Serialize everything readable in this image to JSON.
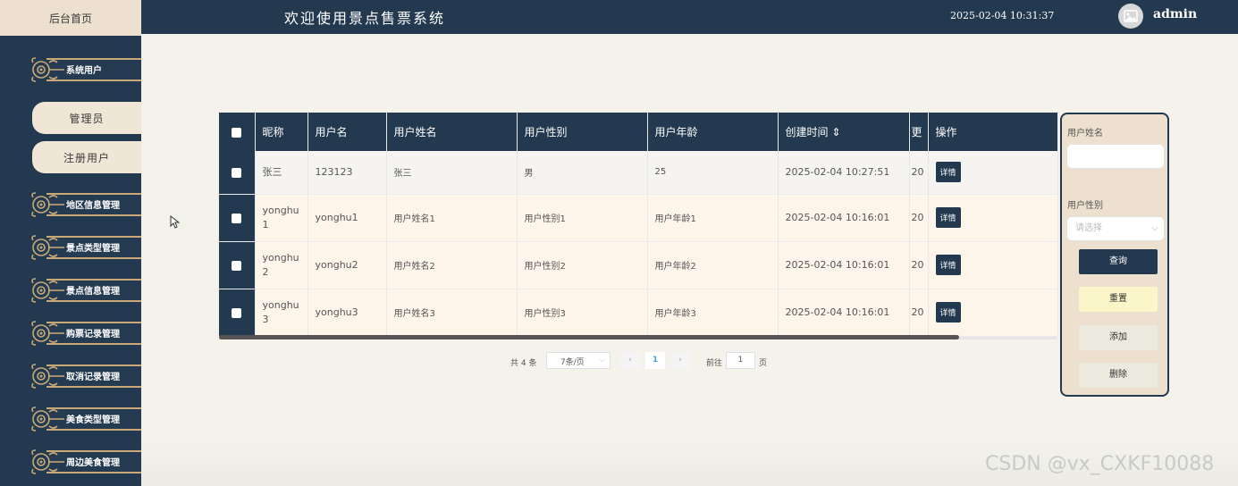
{
  "header": {
    "home_label": "后台首页",
    "app_title": "欢迎使用景点售票系统",
    "datetime": "2025-02-04 10:31:37",
    "user": "admin"
  },
  "sidebar": {
    "menus": [
      {
        "label": "系统用户"
      },
      {
        "label": "地区信息管理"
      },
      {
        "label": "景点类型管理"
      },
      {
        "label": "景点信息管理"
      },
      {
        "label": "购票记录管理"
      },
      {
        "label": "取消记录管理"
      },
      {
        "label": "美食类型管理"
      },
      {
        "label": "周边美食管理"
      }
    ],
    "submenus": [
      {
        "label": "管理员"
      },
      {
        "label": "注册用户"
      }
    ]
  },
  "table": {
    "columns": [
      "昵称",
      "用户名",
      "用户姓名",
      "用户性别",
      "用户年龄",
      "创建时间 ⇕",
      "更",
      "操作"
    ],
    "detail_label": "详情",
    "rows": [
      {
        "nickname": "张三",
        "username": "123123",
        "realname": "张三",
        "gender": "男",
        "age": "25",
        "created": "2025-02-04 10:27:51",
        "updated": "20"
      },
      {
        "nickname": "yonghu1",
        "username": "yonghu1",
        "realname": "用户姓名1",
        "gender": "用户性别1",
        "age": "用户年龄1",
        "created": "2025-02-04 10:16:01",
        "updated": "20"
      },
      {
        "nickname": "yonghu2",
        "username": "yonghu2",
        "realname": "用户姓名2",
        "gender": "用户性别2",
        "age": "用户年龄2",
        "created": "2025-02-04 10:16:01",
        "updated": "20"
      },
      {
        "nickname": "yonghu3",
        "username": "yonghu3",
        "realname": "用户姓名3",
        "gender": "用户性别3",
        "age": "用户年龄3",
        "created": "2025-02-04 10:16:01",
        "updated": "20"
      }
    ]
  },
  "pager": {
    "total": "共 4 条",
    "page_size": "7条/页",
    "prev": "‹",
    "current": "1",
    "next": "›",
    "goto_prefix": "前往",
    "goto_value": "1",
    "goto_suffix": "页"
  },
  "search": {
    "name_label": "用户姓名",
    "gender_label": "用户性别",
    "gender_placeholder": "请选择",
    "query": "查询",
    "reset": "重置",
    "add": "添加",
    "delete": "删除"
  },
  "watermark": "CSDN @vx_CXKF10088",
  "colors": {
    "navy": "#23394f",
    "beige": "#ede0cf",
    "gold": "#c9a97a"
  }
}
